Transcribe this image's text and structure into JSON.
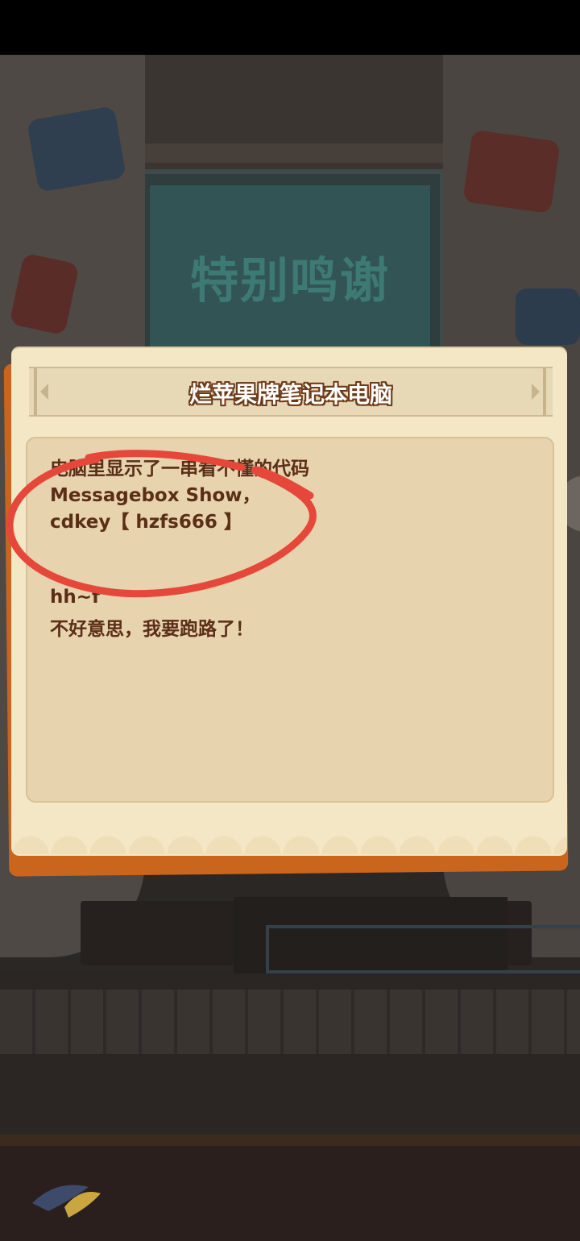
{
  "background": {
    "screen_text": "特别鸣谢"
  },
  "dialog": {
    "title": "烂苹果牌笔记本电脑",
    "lines": [
      "电脑里显示了一串看不懂的代码",
      "Messagebox Show，",
      "cdkey【 hzfs666 】",
      "hh~f",
      "不好意思，我要跑路了！"
    ]
  },
  "colors": {
    "dialog_bg": "#f4e7c6",
    "content_bg": "#e7d3ad",
    "text": "#5a2e17",
    "accent_orange": "#c9651d",
    "annotation_red": "#e5483b"
  },
  "icons": {
    "side_tab": "chevron-left-icon"
  }
}
